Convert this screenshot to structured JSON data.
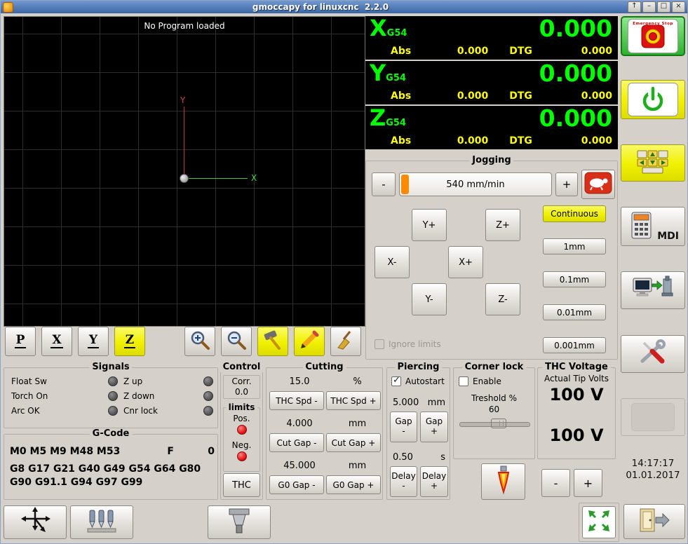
{
  "titlebar": {
    "title": "gmoccapy for linuxcnc  2.2.0",
    "controls": [
      "↑",
      "–",
      "□",
      "×"
    ]
  },
  "preview": {
    "message": "No Program loaded",
    "x_axis": "X",
    "y_axis": "Y"
  },
  "preview_toolbar": {
    "axis_buttons": [
      "P",
      "X",
      "Y",
      "Z"
    ]
  },
  "dro": {
    "axes": [
      {
        "letter": "X",
        "system": "G54",
        "value": "0.000",
        "abs_label": "Abs",
        "abs_value": "0.000",
        "dtg_label": "DTG",
        "dtg_value": "0.000"
      },
      {
        "letter": "Y",
        "system": "G54",
        "value": "0.000",
        "abs_label": "Abs",
        "abs_value": "0.000",
        "dtg_label": "DTG",
        "dtg_value": "0.000"
      },
      {
        "letter": "Z",
        "system": "G54",
        "value": "0.000",
        "abs_label": "Abs",
        "abs_value": "0.000",
        "dtg_label": "DTG",
        "dtg_value": "0.000"
      }
    ]
  },
  "jogging": {
    "title": "Jogging",
    "minus": "-",
    "plus": "+",
    "speed": "540 mm/min",
    "continuous": "Continuous",
    "buttons": [
      "Y+",
      "Z+",
      "X-",
      "X+",
      "Y-",
      "Z-"
    ],
    "increments": [
      "1mm",
      "0.1mm",
      "0.01mm",
      "0.001mm"
    ],
    "ignore_limits": "Ignore limits"
  },
  "signals": {
    "title": "Signals",
    "left": [
      "Float Sw",
      "Torch On",
      "Arc OK"
    ],
    "right": [
      "Z up",
      "Z down",
      "Cnr lock"
    ]
  },
  "gcode": {
    "title": "G-Code",
    "mcodes": "M0 M5 M9 M48 M53",
    "f_label": "F",
    "f_value": "0",
    "gcodes": "G8 G17 G21 G40 G49 G54 G64 G80 G90 G91.1 G94 G97 G99"
  },
  "control": {
    "title": "Control",
    "corr_label": "Corr.",
    "corr_value": "0.0",
    "limits_title": "limits",
    "pos_label": "Pos.",
    "neg_label": "Neg.",
    "thc_button": "THC"
  },
  "cutting": {
    "title": "Cutting",
    "rows": [
      {
        "value": "15.0",
        "unit": "%",
        "minus": "THC Spd -",
        "plus": "THC Spd +"
      },
      {
        "value": "4.000",
        "unit": "mm",
        "minus": "Cut Gap -",
        "plus": "Cut Gap +"
      },
      {
        "value": "45.000",
        "unit": "mm",
        "minus": "G0 Gap -",
        "plus": "G0 Gap +"
      }
    ]
  },
  "piercing": {
    "title": "Piercing",
    "autostart": "Autostart",
    "height_value": "5.000",
    "height_unit": "mm",
    "gap_label": "Gap",
    "minus": "-",
    "plus": "+",
    "delay_value": "0.50",
    "delay_unit": "s",
    "delay_label": "Delay"
  },
  "corner_lock": {
    "title": "Corner lock",
    "enable": "Enable",
    "threshold_label": "Treshold %",
    "threshold_value": "60"
  },
  "thc_voltage": {
    "title": "THC Voltage",
    "subtitle": "Actual Tip Volts",
    "volts_top": "100 V",
    "volts_bottom": "100 V",
    "minus": "-",
    "plus": "+"
  },
  "right_panel": {
    "estop_text": "Emergency Stop",
    "mdi_label": "MDI",
    "time": "14:17:17",
    "date": "01.01.2017"
  },
  "colors": {
    "dro_green": "#00ff00",
    "dro_yellow": "#ffff00",
    "highlight_yellow": "#f0f000",
    "led_red": "#dd0000",
    "slider_fill": "#ff8a00",
    "estop_green": "#46c846"
  }
}
